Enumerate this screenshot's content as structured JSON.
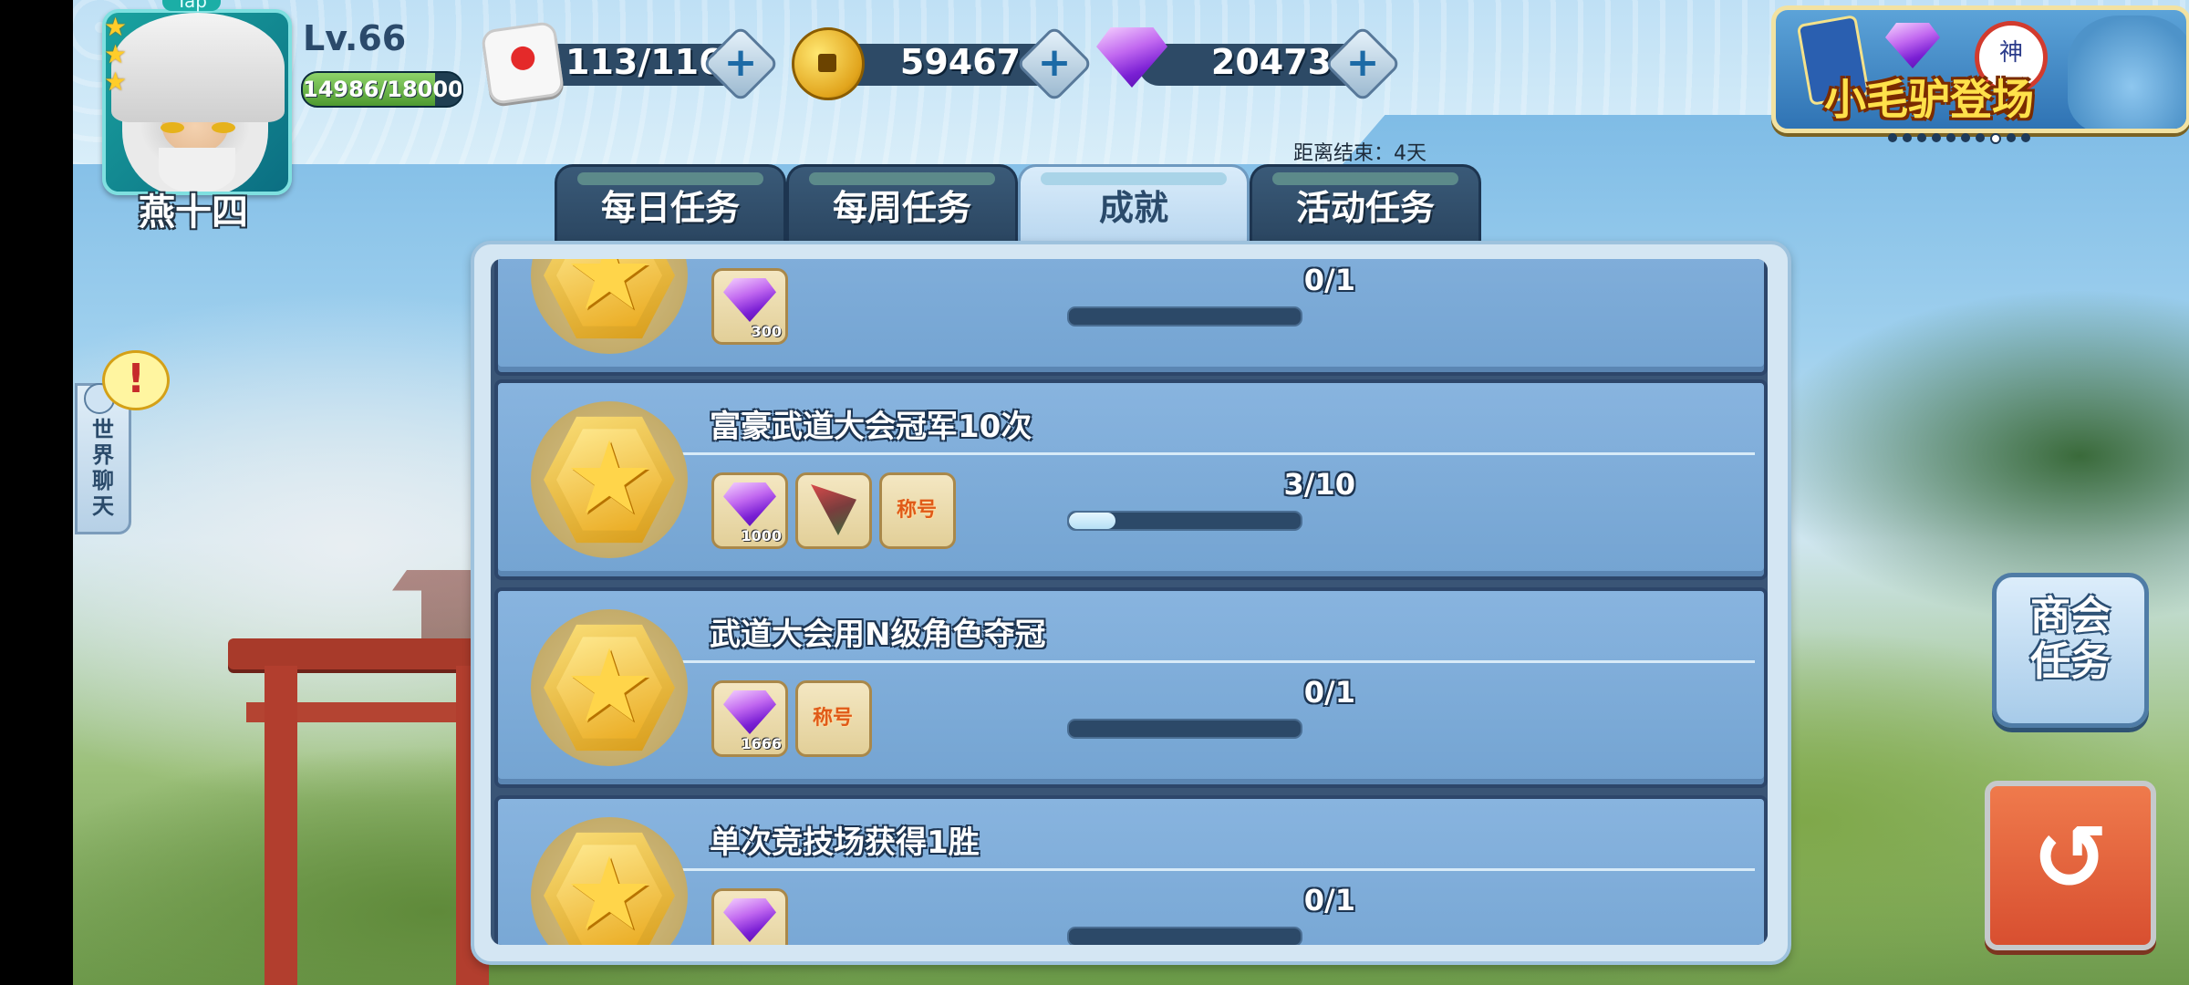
{
  "player": {
    "tap_badge": "Tap",
    "name": "燕十四",
    "level": "Lv.66",
    "exp_text": "14986/18000",
    "exp_fraction": 0.8326
  },
  "resources": {
    "stamina": "113/116",
    "coins": "59467",
    "gems": "20473",
    "plus_label": "+"
  },
  "event_banner": {
    "title": "小毛驴登场",
    "seal_text": "神",
    "page_count": 10,
    "active_page": 8
  },
  "countdown": "距离结束：4天",
  "tabs": [
    {
      "label": "每日任务",
      "active": false
    },
    {
      "label": "每周任务",
      "active": false
    },
    {
      "label": "成就",
      "active": true
    },
    {
      "label": "活动任务",
      "active": false
    }
  ],
  "tasks": [
    {
      "title": "",
      "progress_text": "0/1",
      "progress_fraction": 0,
      "rewards": [
        {
          "type": "gem-icon",
          "qty": "300"
        }
      ]
    },
    {
      "title": "富豪武道大会冠军10次",
      "progress_text": "3/10",
      "progress_fraction": 0.2,
      "rewards": [
        {
          "type": "gem-icon",
          "qty": "1000"
        },
        {
          "type": "drill-icon",
          "qty": ""
        },
        {
          "type": "title-badge",
          "label": "称号"
        }
      ]
    },
    {
      "title": "武道大会用N级角色夺冠",
      "progress_text": "0/1",
      "progress_fraction": 0,
      "rewards": [
        {
          "type": "gem-icon",
          "qty": "1666"
        },
        {
          "type": "title-badge",
          "label": "称号"
        }
      ]
    },
    {
      "title": "单次竞技场获得1胜",
      "progress_text": "0/1",
      "progress_fraction": 0,
      "rewards": [
        {
          "type": "gem-icon",
          "qty": ""
        }
      ]
    }
  ],
  "chat": {
    "label": "世界聊天",
    "alert": "!"
  },
  "side_button": {
    "label": "商会任务"
  },
  "colors": {
    "accent": "#2d4a66",
    "gem": "#7a1fd4",
    "coin": "#e1a41c",
    "back_button": "#d84f30"
  }
}
